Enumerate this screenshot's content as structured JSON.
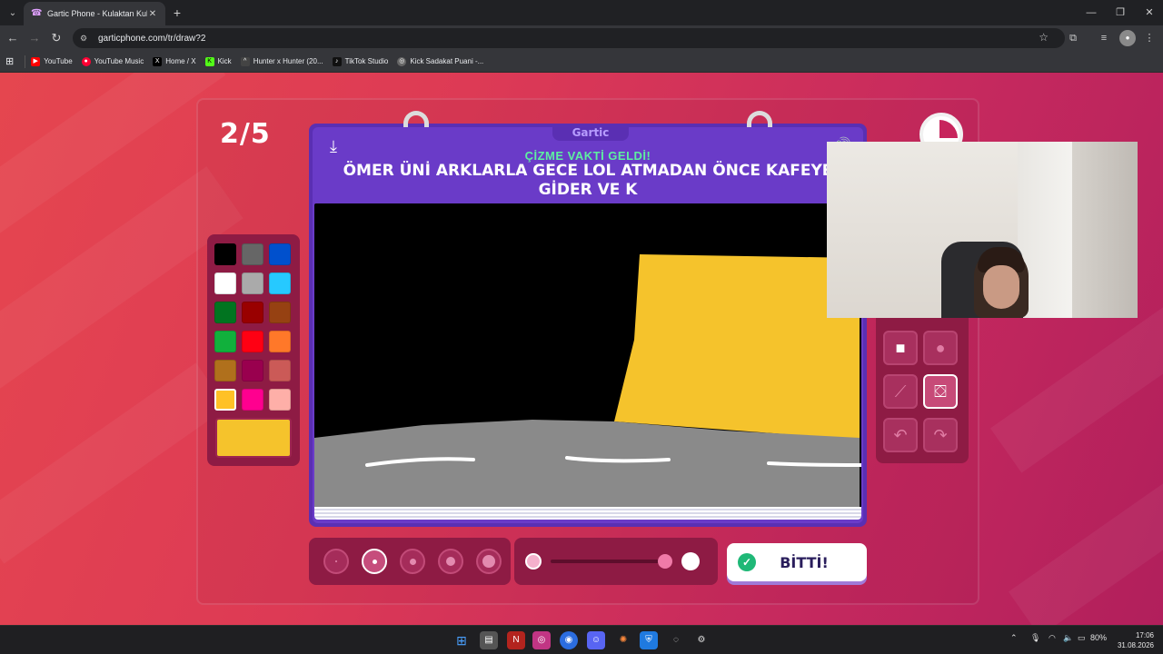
{
  "browser": {
    "tab_title": "Gartic Phone - Kulaktan Kulağa",
    "url": "garticphone.com/tr/draw?2",
    "bookmarks": [
      {
        "label": "YouTube",
        "color": "#ff0000"
      },
      {
        "label": "YouTube Music",
        "color": "#ff0033"
      },
      {
        "label": "Home / X",
        "color": "#000000"
      },
      {
        "label": "Kick",
        "color": "#53fc18"
      },
      {
        "label": "Hunter x Hunter (20...",
        "color": "#444444"
      },
      {
        "label": "TikTok Studio",
        "color": "#111111"
      },
      {
        "label": "Kick Sadakat Puani -...",
        "color": "#666666"
      }
    ]
  },
  "game": {
    "round": "2/5",
    "brand": "Gartic",
    "prompt_title": "ÇİZME VAKTİ GELDİ!",
    "prompt_text": "ÖMER ÜNİ ARKLARLA GECE LOL ATMADAN ÖNCE KAFEYE GİDER VE K",
    "done_label": "BİTTİ!",
    "palette": [
      "#000000",
      "#666666",
      "#0050cd",
      "#ffffff",
      "#aaaaaa",
      "#26c9ff",
      "#017420",
      "#990000",
      "#964112",
      "#11b03c",
      "#ff0013",
      "#ff7829",
      "#b0701c",
      "#99004e",
      "#cb5a57",
      "#ffc126",
      "#ff008f",
      "#feafa8"
    ],
    "selected_color": "#f5c32c",
    "selected_tool": "fill-bucket",
    "selected_size_index": 1,
    "opacity": 1.0
  },
  "taskbar": {
    "battery": "80%",
    "time": "17:06",
    "date": "31.08.2026"
  }
}
